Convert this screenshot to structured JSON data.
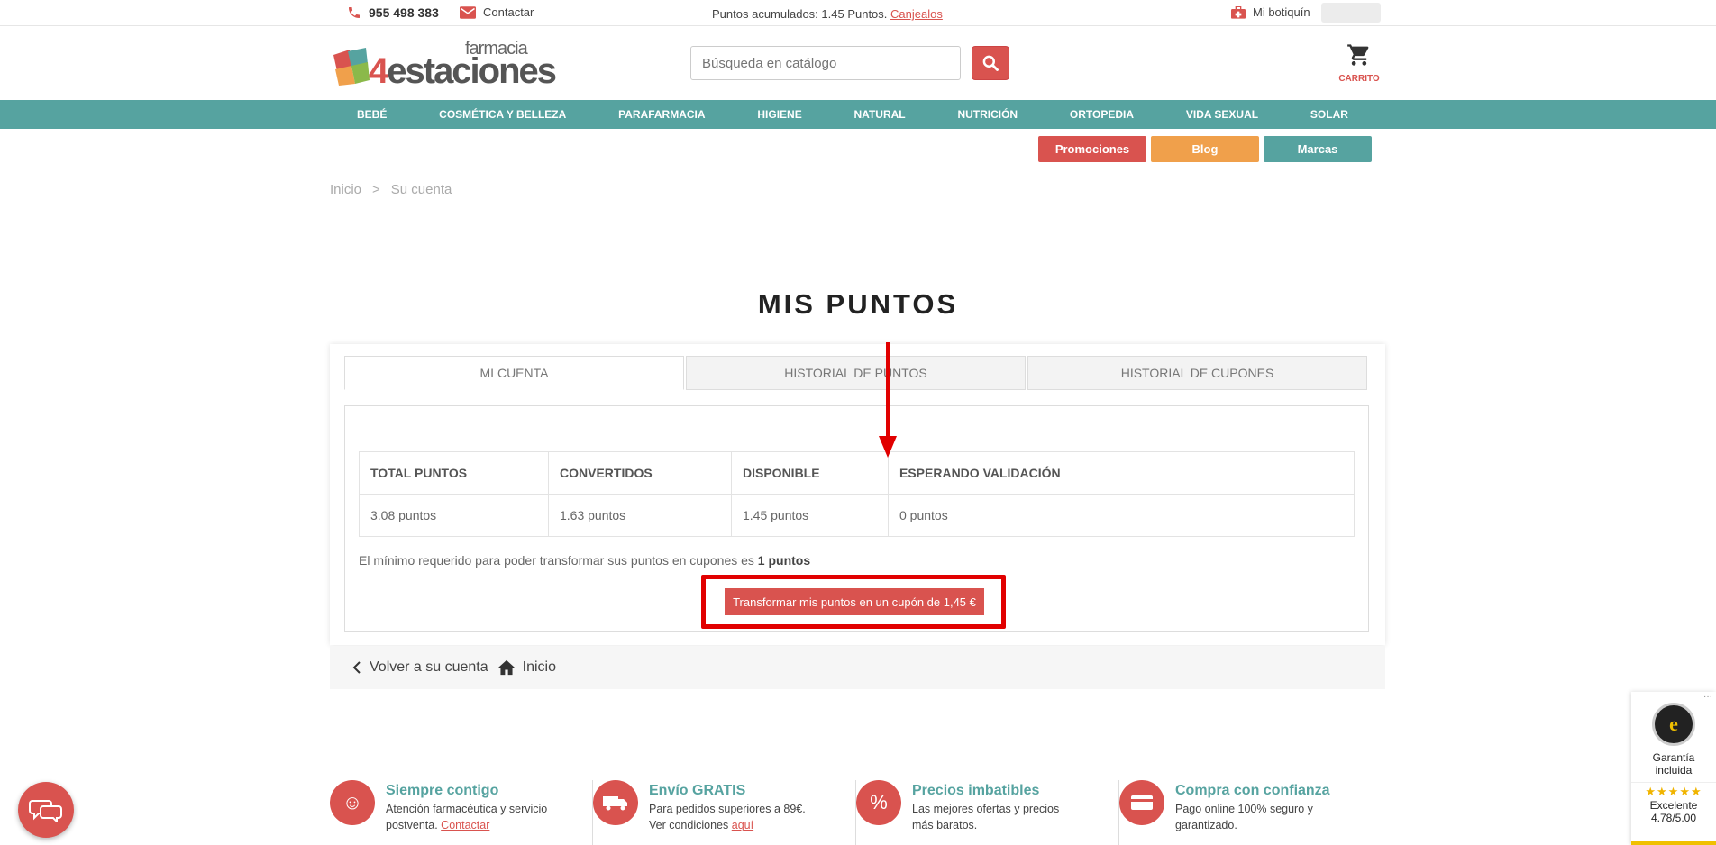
{
  "topbar": {
    "phone": "955 498 383",
    "contact": "Contactar",
    "points_text": "Puntos acumulados: 1.45 Puntos.",
    "points_link": "Canjealos",
    "botiquin": "Mi botiquín"
  },
  "header": {
    "logo_farmacia": "farmacia",
    "logo_four": "4",
    "logo_word": "estaciones",
    "search_placeholder": "Búsqueda en catálogo",
    "cart_label": "CARRITO"
  },
  "nav": {
    "items": [
      "BEBÉ",
      "COSMÉTICA Y BELLEZA",
      "PARAFARMACIA",
      "HIGIENE",
      "NATURAL",
      "NUTRICIÓN",
      "ORTOPEDIA",
      "VIDA SEXUAL",
      "SOLAR"
    ]
  },
  "pills": {
    "promociones": "Promociones",
    "blog": "Blog",
    "marcas": "Marcas"
  },
  "breadcrumb": {
    "home": "Inicio",
    "separator": ">",
    "current": "Su cuenta"
  },
  "page": {
    "title": "MIS PUNTOS"
  },
  "tabs": [
    "MI CUENTA",
    "HISTORIAL DE PUNTOS",
    "HISTORIAL DE CUPONES"
  ],
  "points_table": {
    "headers": [
      "TOTAL PUNTOS",
      "CONVERTIDOS",
      "DISPONIBLE",
      "ESPERANDO VALIDACIÓN"
    ],
    "values": [
      "3.08 puntos",
      "1.63 puntos",
      "1.45 puntos",
      "0 puntos"
    ]
  },
  "minimum": {
    "text": "El mínimo requerido para poder transformar sus puntos en cupones es",
    "value": "1 puntos"
  },
  "transform_button": "Transformar mis puntos en un cupón de 1,45 €",
  "back_bar": {
    "back": "Volver a su cuenta",
    "home": "Inicio"
  },
  "features": [
    {
      "title": "Siempre contigo",
      "line1": "Atención farmacéutica y servicio",
      "line2": "postventa.",
      "link": "Contactar"
    },
    {
      "title": "Envío GRATIS",
      "line1": "Para pedidos superiores a 89€.",
      "line2": "Ver condiciones",
      "link": "aquí"
    },
    {
      "title": "Precios imbatibles",
      "line1": "Las mejores ofertas y precios",
      "line2": "más baratos.",
      "link": ""
    },
    {
      "title": "Compra con confianza",
      "line1": "Pago online 100% seguro y",
      "line2": "garantizado.",
      "link": ""
    }
  ],
  "trusted": {
    "seal_letter": "e",
    "line1": "Garantía",
    "line2": "incluida",
    "stars": "★★★★★",
    "rating_label": "Excelente",
    "rating_value": "4.78/5.00",
    "more": "···"
  },
  "colors": {
    "accent_red": "#d9534f",
    "teal": "#56a3a0",
    "orange": "#f0a04b",
    "highlight": "#e10000"
  }
}
